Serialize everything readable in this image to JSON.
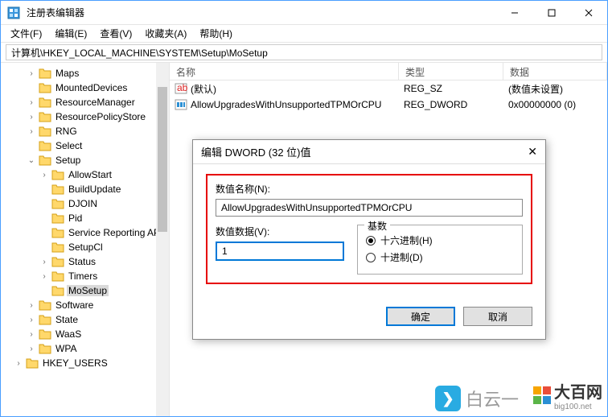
{
  "window": {
    "title": "注册表编辑器"
  },
  "menu": {
    "file": "文件(F)",
    "edit": "编辑(E)",
    "view": "查看(V)",
    "favorites": "收藏夹(A)",
    "help": "帮助(H)"
  },
  "address": {
    "path": "计算机\\HKEY_LOCAL_MACHINE\\SYSTEM\\Setup\\MoSetup"
  },
  "tree": {
    "items": [
      {
        "label": "Maps",
        "level": 2,
        "chev": "collapsed"
      },
      {
        "label": "MountedDevices",
        "level": 2,
        "chev": "none"
      },
      {
        "label": "ResourceManager",
        "level": 2,
        "chev": "collapsed"
      },
      {
        "label": "ResourcePolicyStore",
        "level": 2,
        "chev": "collapsed"
      },
      {
        "label": "RNG",
        "level": 2,
        "chev": "collapsed"
      },
      {
        "label": "Select",
        "level": 2,
        "chev": "none"
      },
      {
        "label": "Setup",
        "level": 2,
        "chev": "expanded"
      },
      {
        "label": "AllowStart",
        "level": 3,
        "chev": "collapsed"
      },
      {
        "label": "BuildUpdate",
        "level": 3,
        "chev": "none"
      },
      {
        "label": "DJOIN",
        "level": 3,
        "chev": "none"
      },
      {
        "label": "Pid",
        "level": 3,
        "chev": "none"
      },
      {
        "label": "Service Reporting API",
        "level": 3,
        "chev": "none"
      },
      {
        "label": "SetupCl",
        "level": 3,
        "chev": "none"
      },
      {
        "label": "Status",
        "level": 3,
        "chev": "collapsed"
      },
      {
        "label": "Timers",
        "level": 3,
        "chev": "collapsed"
      },
      {
        "label": "MoSetup",
        "level": 3,
        "chev": "none",
        "selected": true
      },
      {
        "label": "Software",
        "level": 2,
        "chev": "collapsed"
      },
      {
        "label": "State",
        "level": 2,
        "chev": "collapsed"
      },
      {
        "label": "WaaS",
        "level": 2,
        "chev": "collapsed"
      },
      {
        "label": "WPA",
        "level": 2,
        "chev": "collapsed"
      },
      {
        "label": "HKEY_USERS",
        "level": 1,
        "chev": "collapsed"
      }
    ]
  },
  "list": {
    "headers": {
      "name": "名称",
      "type": "类型",
      "data": "数据"
    },
    "rows": [
      {
        "name": "(默认)",
        "type": "REG_SZ",
        "data": "(数值未设置)",
        "icon": "sz"
      },
      {
        "name": "AllowUpgradesWithUnsupportedTPMOrCPU",
        "type": "REG_DWORD",
        "data": "0x00000000 (0)",
        "icon": "dw"
      }
    ]
  },
  "dialog": {
    "title": "编辑 DWORD (32 位)值",
    "name_label": "数值名称(N):",
    "name_value": "AllowUpgradesWithUnsupportedTPMOrCPU",
    "data_label": "数值数据(V):",
    "data_value": "1",
    "radix_legend": "基数",
    "hex_label": "十六进制(H)",
    "dec_label": "十进制(D)",
    "ok": "确定",
    "cancel": "取消"
  },
  "brand": {
    "wm1": "白云一",
    "wm2": "大百网",
    "wm2_sub": "big100.net"
  }
}
